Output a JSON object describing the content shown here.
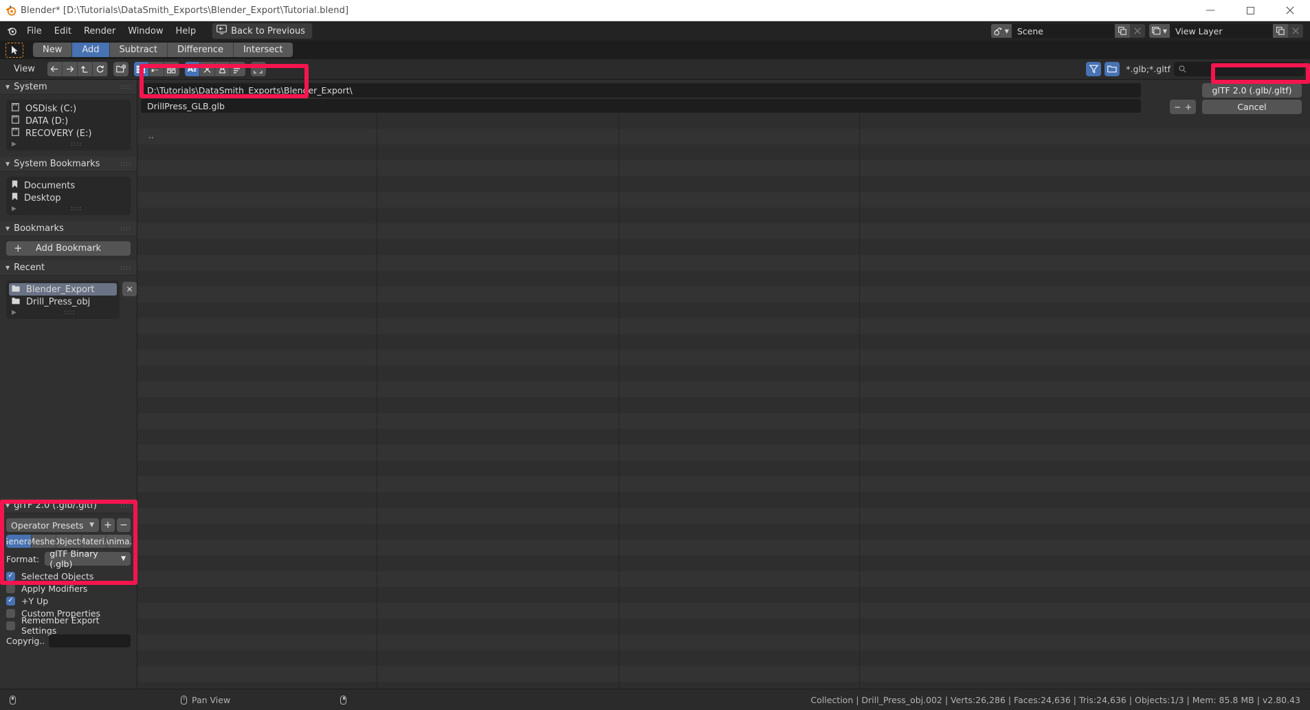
{
  "window": {
    "title": "Blender* [D:\\Tutorials\\DataSmith_Exports\\Blender_Export\\Tutorial.blend]",
    "minimize": "—",
    "maximize": "☐",
    "close": "✕"
  },
  "topbar": {
    "menus": [
      "File",
      "Edit",
      "Render",
      "Window",
      "Help"
    ],
    "back_to_previous": "Back to Previous",
    "scene_value": "Scene",
    "view_layer_value": "View Layer"
  },
  "toolrow": {
    "modes": [
      {
        "label": "New",
        "active": false
      },
      {
        "label": "Add",
        "active": true
      },
      {
        "label": "Subtract",
        "active": false
      },
      {
        "label": "Difference",
        "active": false
      },
      {
        "label": "Intersect",
        "active": false
      }
    ]
  },
  "filebrowser_header": {
    "view_menu": "View",
    "nav_icons": [
      "back-arrow-icon",
      "forward-arrow-icon",
      "up-arrow-icon",
      "refresh-icon",
      "new-folder-icon"
    ],
    "display_icons": [
      "vertical-list-icon",
      "horizontal-list-icon",
      "thumbnail-grid-icon"
    ],
    "sort_icons": [
      "sort-alpha-icon",
      "sort-extension-icon",
      "sort-time-icon",
      "sort-size-icon"
    ],
    "filter_enabled_icon": "filter-funnel-icon",
    "folder_filter_icon": "folder-filter-icon",
    "filter_text": "*.glb;*.gltf",
    "search_placeholder": ""
  },
  "sidebar": {
    "system": {
      "title": "System",
      "items": [
        "OSDisk (C:)",
        "DATA (D:)",
        "RECOVERY (E:)"
      ]
    },
    "system_bookmarks": {
      "title": "System Bookmarks",
      "items": [
        "Documents",
        "Desktop"
      ]
    },
    "bookmarks": {
      "title": "Bookmarks",
      "add_label": "Add Bookmark"
    },
    "recent": {
      "title": "Recent",
      "items": [
        {
          "label": "Blender_Export",
          "selected": true
        },
        {
          "label": "Drill_Press_obj",
          "selected": false
        }
      ],
      "clear_label": "✕"
    }
  },
  "operator_panel": {
    "title": "glTF 2.0 (.glb/.gltf)",
    "preset_value": "Operator Presets",
    "add_preset": "+",
    "remove_preset": "−",
    "tabs": [
      {
        "label": "General",
        "active": true
      },
      {
        "label": "Meshes",
        "active": false
      },
      {
        "label": "Objects",
        "active": false
      },
      {
        "label": "Materi..",
        "active": false
      },
      {
        "label": "Anima..",
        "active": false
      }
    ],
    "format_label": "Format:",
    "format_value": "glTF Binary (.glb)",
    "checkboxes": [
      {
        "label": "Selected Objects",
        "checked": true
      },
      {
        "label": "Apply Modifiers",
        "checked": false
      },
      {
        "label": "+Y Up",
        "checked": true
      },
      {
        "label": "Custom Properties",
        "checked": false
      },
      {
        "label": "Remember Export Settings",
        "checked": false
      }
    ],
    "copyright_label": "Copyrig..",
    "copyright_value": ""
  },
  "main": {
    "path_value": "D:\\Tutorials\\DataSmith_Exports\\Blender_Export\\",
    "filename_value": "DrillPress_GLB.glb",
    "parent_entry": "..",
    "export_button": "glTF 2.0 (.glb/.gltf)",
    "cancel_button": "Cancel",
    "step_minus": "−",
    "step_plus": "+"
  },
  "statusbar": {
    "left_mouse_icon": "mouse-left-icon",
    "middle_label": "Pan View",
    "right_mouse_icon": "mouse-right-icon",
    "stats": "Collection | Drill_Press_obj.002 | Verts:26,286 | Faces:24,636 | Tris:24,636 | Objects:1/3 | Mem: 85.8 MB | v2.80.43"
  },
  "colors": {
    "accent_blue": "#4772b3",
    "annotation_red": "#f5154e",
    "selection_grey": "#6a7285"
  }
}
